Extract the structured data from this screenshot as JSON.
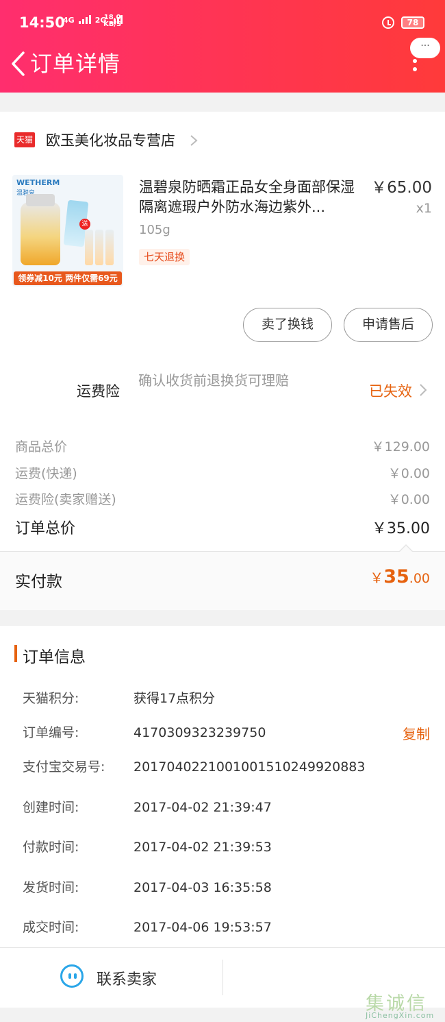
{
  "status_bar": {
    "time": "14:50",
    "net1": "4G",
    "net2": "2G",
    "speed_value": "18.0",
    "speed_unit": "KB/S",
    "battery": "78"
  },
  "nav": {
    "title": "订单详情",
    "more_label": "···"
  },
  "shop": {
    "badge": "天猫",
    "name": "欧玉美化妆品专营店"
  },
  "product": {
    "image": {
      "brand": "WETHERM",
      "brand_sub": "温碧泉",
      "gift": "送",
      "promo": "领券减10元 两件仅需69元"
    },
    "title": "温碧泉防晒霜正品女全身面部保湿隔离遮瑕户外防水海边紫外...",
    "price": "￥65.00",
    "qty": "x1",
    "spec": "105g",
    "tag": "七天退换"
  },
  "actions": {
    "sell_label": "卖了换钱",
    "aftersale_label": "申请售后"
  },
  "insurance": {
    "label": "运费险",
    "desc": "确认收货前退换货可理赔",
    "status": "已失效"
  },
  "fees": [
    {
      "label": "商品总价",
      "value": "￥129.00"
    },
    {
      "label": "运费(快递)",
      "value": "￥0.00"
    },
    {
      "label": "运费险(卖家赠送)",
      "value": "￥0.00"
    }
  ],
  "order_total": {
    "label": "订单总价",
    "value": "￥35.00"
  },
  "paid": {
    "label": "实付款",
    "currency": "￥",
    "integer": "35",
    "decimal": ".00"
  },
  "order_info": {
    "title": "订单信息",
    "copy_label": "复制",
    "rows": [
      {
        "label": "天猫积分:",
        "value": "获得17点积分"
      },
      {
        "label": "订单编号:",
        "value": "4170309323239750"
      },
      {
        "label": "支付宝交易号:",
        "value": "2017040221001001510249920883"
      },
      {
        "label": "创建时间:",
        "value": "2017-04-02 21:39:47"
      },
      {
        "label": "付款时间:",
        "value": "2017-04-02 21:39:53"
      },
      {
        "label": "发货时间:",
        "value": "2017-04-03 16:35:58"
      },
      {
        "label": "成交时间:",
        "value": "2017-04-06 19:53:57"
      }
    ]
  },
  "footer": {
    "contact_label": "联系卖家"
  },
  "watermark": {
    "logo": "集诚信",
    "url": "JiChengXin.com"
  },
  "colors": {
    "header_start": "#ff2e6e",
    "header_end": "#ff3a3a",
    "accent": "#e6620f",
    "contact_blue": "#2aa6e8"
  }
}
